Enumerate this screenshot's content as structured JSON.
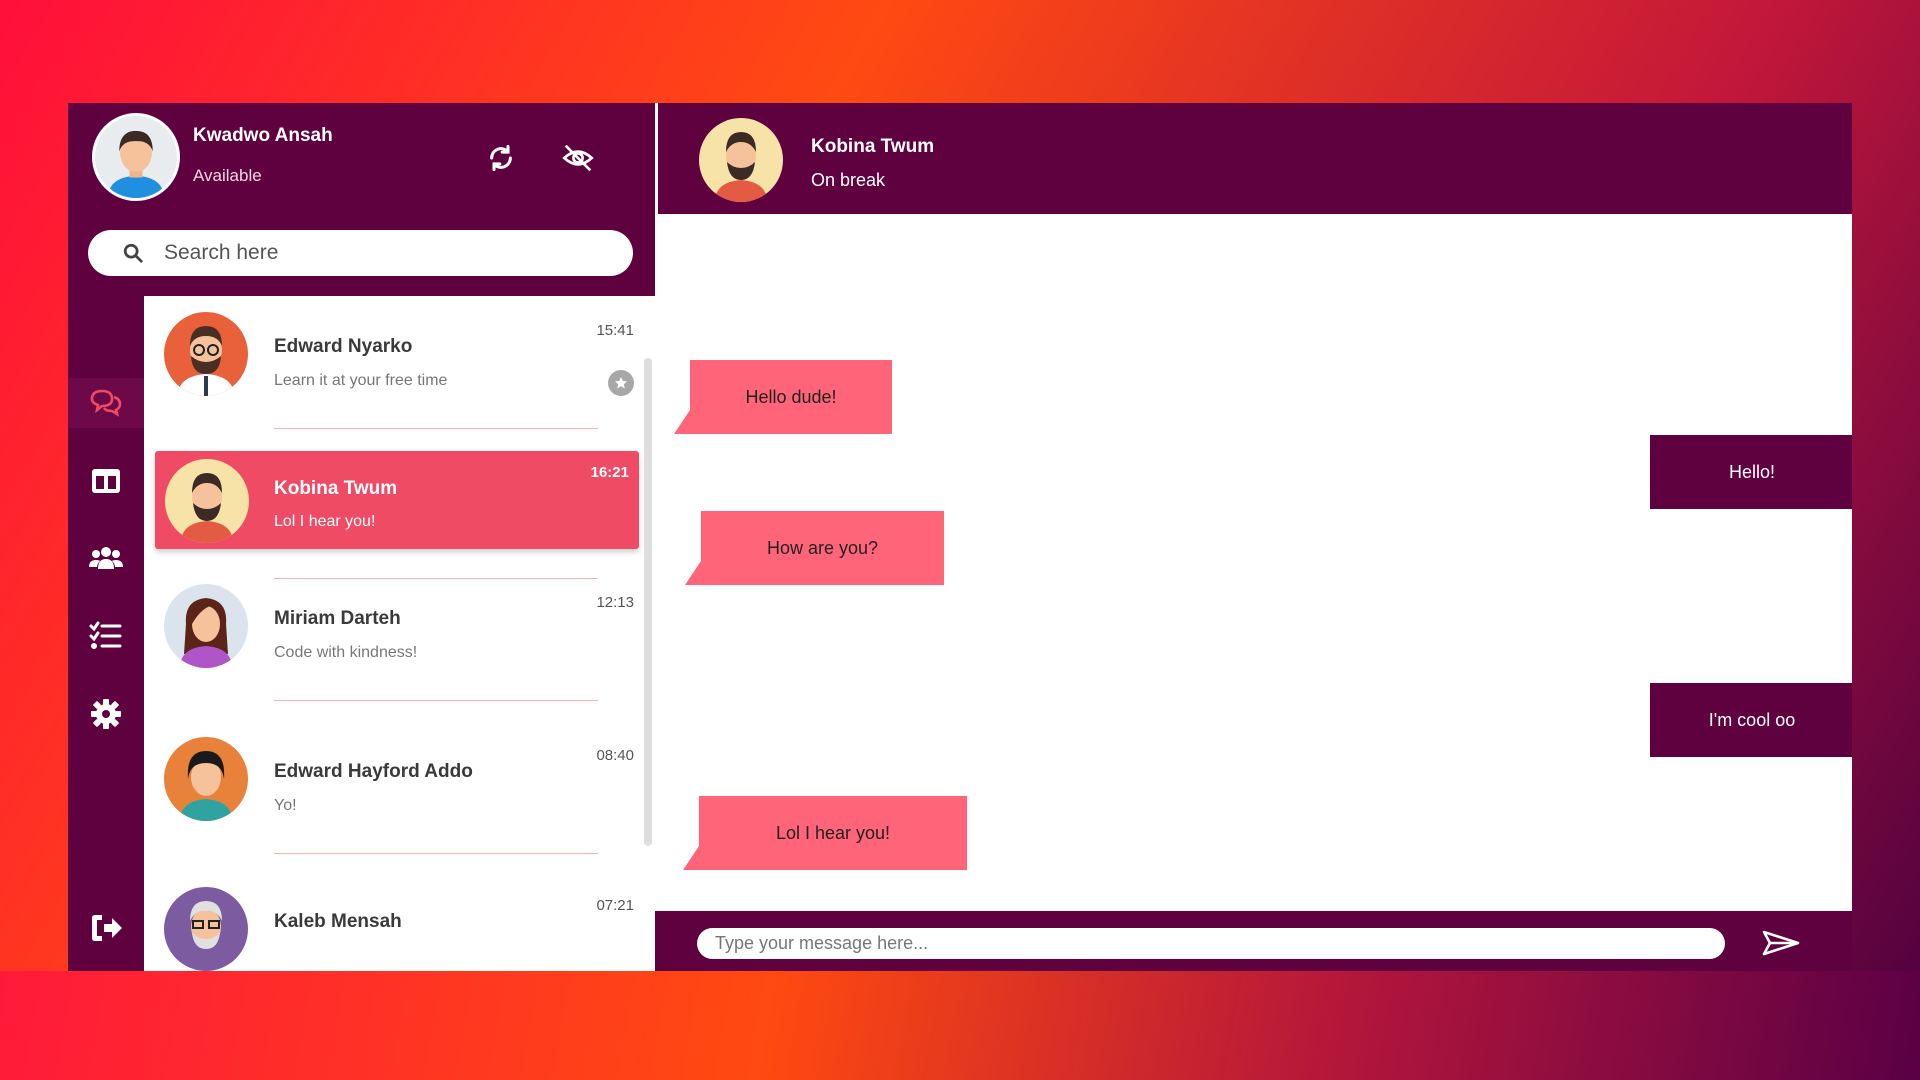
{
  "colors": {
    "primary": "#5f003f",
    "accent": "#ef4b64",
    "incoming_bubble": "#ff6479",
    "outgoing_bubble": "#5f003f"
  },
  "profile": {
    "name": "Kwadwo Ansah",
    "status": "Available",
    "icons": [
      "refresh-icon",
      "eye-slash-icon"
    ]
  },
  "search": {
    "placeholder": "Search here",
    "icon": "search-icon"
  },
  "nav": {
    "items": [
      {
        "icon": "chat-icon",
        "active": true
      },
      {
        "icon": "columns-icon",
        "active": false
      },
      {
        "icon": "users-icon",
        "active": false
      },
      {
        "icon": "task-list-icon",
        "active": false
      },
      {
        "icon": "gear-icon",
        "active": false
      },
      {
        "icon": "sign-out-icon",
        "active": false
      }
    ]
  },
  "chats": [
    {
      "name": "Edward Nyarko",
      "preview": "Learn it at your free time",
      "time": "15:41",
      "pinned": true
    },
    {
      "name": "Kobina Twum",
      "preview": "Lol I hear you!",
      "time": "16:21",
      "active": true
    },
    {
      "name": "Miriam Darteh",
      "preview": "Code with kindness!",
      "time": "12:13"
    },
    {
      "name": "Edward Hayford Addo",
      "preview": "Yo!",
      "time": "08:40"
    },
    {
      "name": "Kaleb Mensah",
      "preview": "",
      "time": "07:21"
    }
  ],
  "conversation": {
    "name": "Kobina Twum",
    "status": "On break",
    "messages": [
      {
        "direction": "in",
        "text": "Hello dude!"
      },
      {
        "direction": "out",
        "text": "Hello!"
      },
      {
        "direction": "in",
        "text": "How are you?"
      },
      {
        "direction": "out",
        "text": "I'm cool oo"
      },
      {
        "direction": "in",
        "text": "Lol I hear you!"
      }
    ]
  },
  "composer": {
    "placeholder": "Type your message here...",
    "send_icon": "send-icon"
  }
}
